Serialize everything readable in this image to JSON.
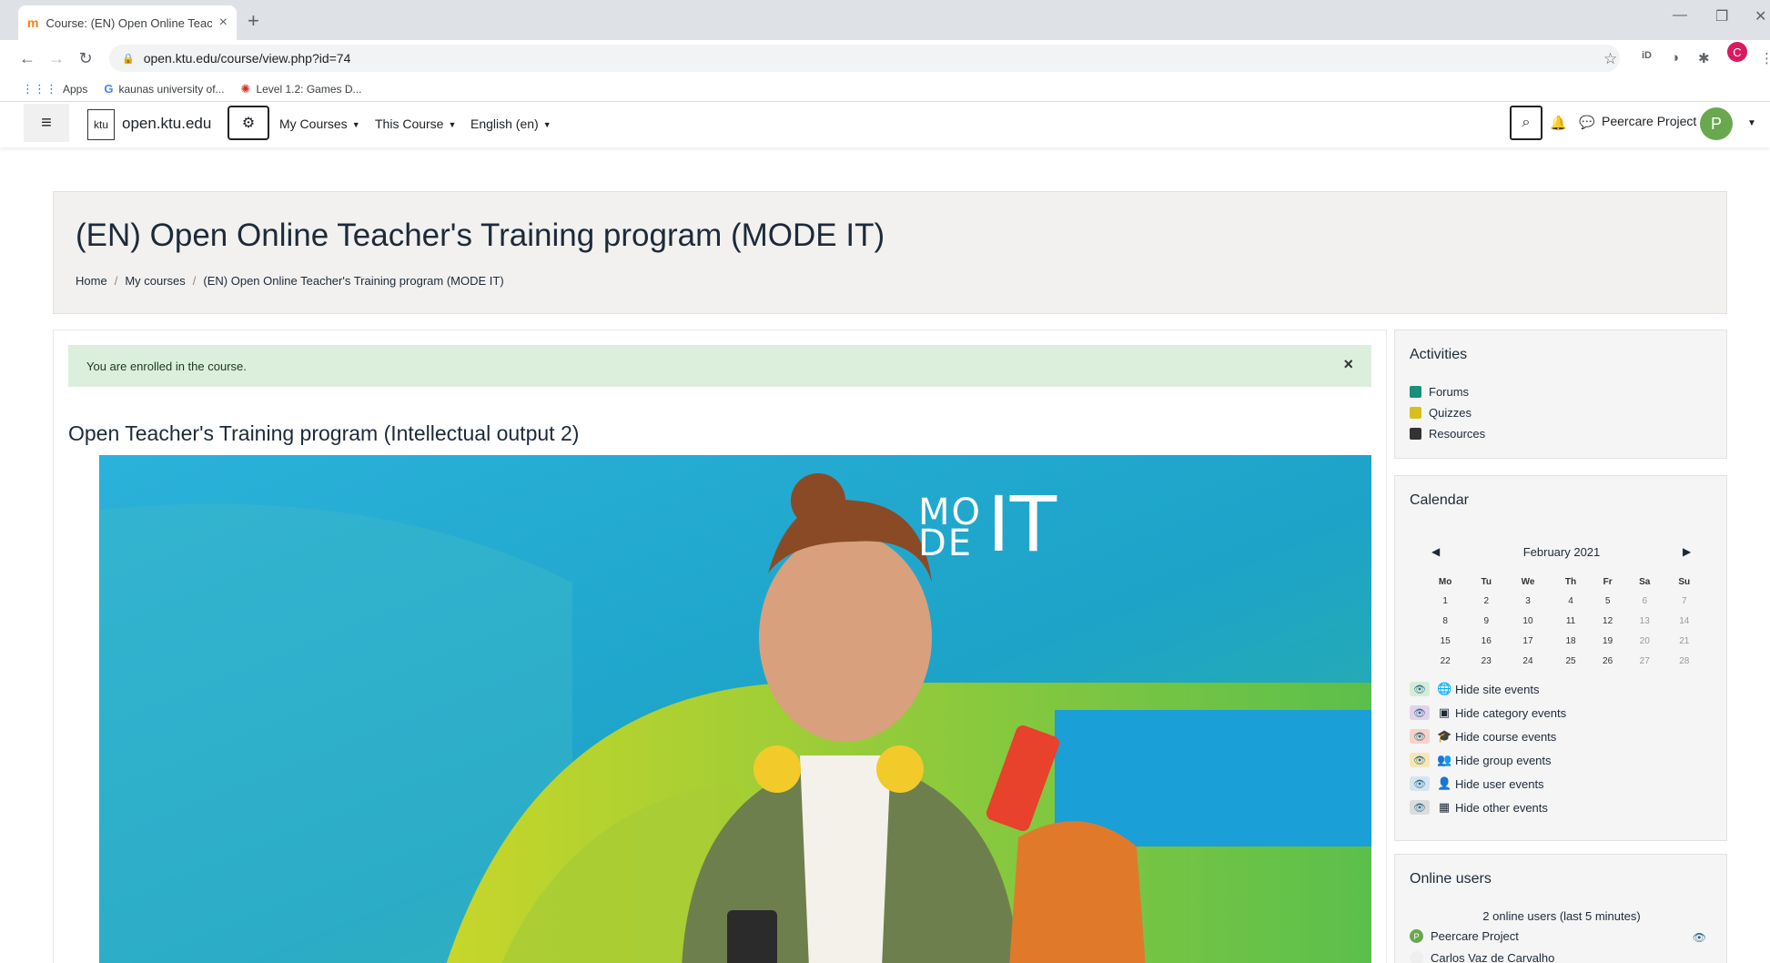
{
  "browser": {
    "tab_title": "Course: (EN) Open Online Teache",
    "url": "open.ktu.edu/course/view.php?id=74",
    "bookmarks": [
      {
        "label": "Apps"
      },
      {
        "label": "kaunas university of..."
      },
      {
        "label": "Level 1.2: Games D..."
      }
    ],
    "profile_initial": "C"
  },
  "navbar": {
    "logo_text": "ktu",
    "site_name": "open.ktu.edu",
    "menus": [
      "My Courses",
      "This Course",
      "English (en)"
    ],
    "user_name": "Peercare Project",
    "user_initial": "P"
  },
  "header": {
    "title": "(EN) Open Online Teacher's Training program (MODE IT)",
    "breadcrumbs": [
      "Home",
      "My courses",
      "(EN) Open Online Teacher's Training program (MODE IT)"
    ]
  },
  "main": {
    "alert": "You are enrolled in the course.",
    "section_title": "Open Teacher's Training program (Intellectual output 2)",
    "hero_logo": [
      "MO",
      "DE",
      "IT"
    ]
  },
  "activities": {
    "title": "Activities",
    "items": [
      {
        "label": "Forums",
        "icon": "forum-icon",
        "color": "#1a8f7a"
      },
      {
        "label": "Quizzes",
        "icon": "quiz-icon",
        "color": "#d6c020"
      },
      {
        "label": "Resources",
        "icon": "resource-icon",
        "color": "#333333"
      }
    ]
  },
  "calendar": {
    "title": "Calendar",
    "month": "February 2021",
    "weekdays": [
      "Mo",
      "Tu",
      "We",
      "Th",
      "Fr",
      "Sa",
      "Su"
    ],
    "weeks": [
      [
        "1",
        "2",
        "3",
        "4",
        "5",
        "6",
        "7"
      ],
      [
        "8",
        "9",
        "10",
        "11",
        "12",
        "13",
        "14"
      ],
      [
        "15",
        "16",
        "17",
        "18",
        "19",
        "20",
        "21"
      ],
      [
        "22",
        "23",
        "24",
        "25",
        "26",
        "27",
        "28"
      ]
    ],
    "events": [
      {
        "label": "Hide site events",
        "icon": "globe-icon",
        "color": "#d6ecd6"
      },
      {
        "label": "Hide category events",
        "icon": "cubes-icon",
        "color": "#e2d3ea"
      },
      {
        "label": "Hide course events",
        "icon": "graduation-cap-icon",
        "color": "#f6d2c8"
      },
      {
        "label": "Hide group events",
        "icon": "group-icon",
        "color": "#f7e7b4"
      },
      {
        "label": "Hide user events",
        "icon": "user-icon",
        "color": "#d6e4f0"
      },
      {
        "label": "Hide other events",
        "icon": "calendar-icon",
        "color": "#dcdcdc"
      }
    ]
  },
  "online_users": {
    "title": "Online users",
    "count_text": "2 online users (last 5 minutes)",
    "users": [
      {
        "name": "Peercare Project",
        "initial": "P"
      },
      {
        "name": "Carlos Vaz de Carvalho",
        "initial": ""
      }
    ]
  }
}
